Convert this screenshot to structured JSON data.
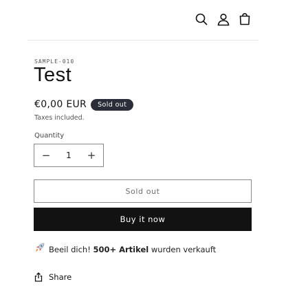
{
  "header": {
    "icons": [
      "search-icon",
      "account-icon",
      "cart-icon"
    ]
  },
  "product": {
    "sku": "SAMPLE-010",
    "title": "Test",
    "price": "€0,00 EUR",
    "badge": "Sold out",
    "taxes_note": "Taxes included."
  },
  "quantity": {
    "label": "Quantity",
    "value": "1",
    "decrease": "−",
    "increase": "+"
  },
  "buttons": {
    "sold_out": "Sold out",
    "buy_now": "Buy it now"
  },
  "promo": {
    "icon": "rocket-icon",
    "prefix": "Beeil dich!",
    "highlight": "500+ Artikel",
    "suffix": "wurden verkauft"
  },
  "share": {
    "label": "Share"
  },
  "colors": {
    "text": "#121212",
    "badge_bg": "#2b2e38",
    "buy_bg": "#121212",
    "border": "#8a8a8a"
  }
}
